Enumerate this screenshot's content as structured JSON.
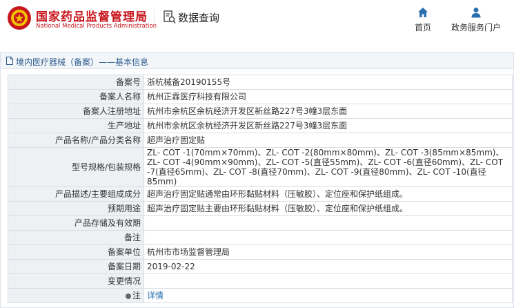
{
  "header": {
    "brand_cn": "国家药品监督管理局",
    "brand_en": "National Medical Products Administration",
    "query_label": "数据查询",
    "nav_home": "首页",
    "nav_service": "政务服务门户",
    "brand_color": "#c8161d",
    "nav_icon_color": "#2a6fb0"
  },
  "panel": {
    "title": "境内医疗器械（备案）——基本信息"
  },
  "rows": [
    {
      "label": "备案号",
      "value": "浙杭械备20190155号"
    },
    {
      "label": "备案人名称",
      "value": "杭州正霖医疗科技有限公司"
    },
    {
      "label": "备案人注册地址",
      "value": "杭州市余杭区余杭经济开发区新丝路227号3幢3层东面"
    },
    {
      "label": "生产地址",
      "value": "杭州市余杭区余杭经济开发区新丝路227号3幢3层东面"
    },
    {
      "label": "产品名称/产品分类名称",
      "value": "超声治疗固定贴"
    },
    {
      "label": "型号规格/包装规格",
      "value": "ZL- COT -1(70mm×70mm)、ZL- COT -2(80mm×80mm)、ZL- COT -3(85mm×85mm)、ZL- COT -4(90mm×90mm)、ZL- COT -5(直径55mm)、ZL- COT -6(直径60mm)、ZL- COT -7(直径65mm)、ZL- COT -8(直径70mm)、ZL- COT -9(直径80mm)、ZL- COT -10(直径85mm)"
    },
    {
      "label": "产品描述/主要组成成分",
      "value": "超声治疗固定贴通常由环形黏贴材料（压敏胶）、定位座和保护纸组成。"
    },
    {
      "label": "预期用途",
      "value": "超声治疗固定贴主要由环形黏贴材料（压敏胶）、定位座和保护纸组成。"
    },
    {
      "label": "产品存储及有效期",
      "value": ""
    },
    {
      "label": "备注",
      "value": ""
    },
    {
      "label": "备案单位",
      "value": "杭州市市场监督管理局"
    },
    {
      "label": "备案日期",
      "value": "2019-02-22"
    },
    {
      "label": "变更情况",
      "value": ""
    },
    {
      "label": "注",
      "value": "详情"
    }
  ]
}
